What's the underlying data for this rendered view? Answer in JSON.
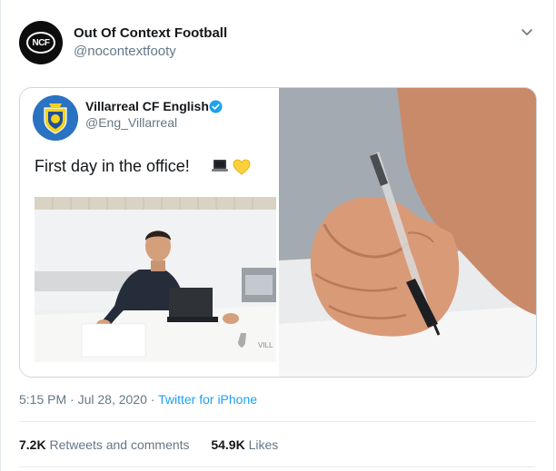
{
  "author": {
    "name": "Out Of Context Football",
    "handle": "@nocontextfooty",
    "avatar_text": "NCF",
    "avatar_icon": "ncf-logo-icon"
  },
  "quoted_tweet": {
    "name": "Villarreal CF English",
    "handle": "@Eng_Villarreal",
    "text": "First day in the office!",
    "emojis": [
      "laptop-icon",
      "yellow-heart-icon"
    ],
    "photo_caption": "VILL"
  },
  "meta": {
    "time": "5:15 PM",
    "date": "Jul 28, 2020",
    "dot": "·",
    "source": "Twitter for iPhone"
  },
  "stats": {
    "retweets_count": "7.2K",
    "retweets_label": "Retweets and comments",
    "likes_count": "54.9K",
    "likes_label": "Likes"
  },
  "colors": {
    "link": "#1da1f2",
    "secondary_text": "#657786",
    "border": "#ccd6dd",
    "verified": "#1da1f2"
  }
}
